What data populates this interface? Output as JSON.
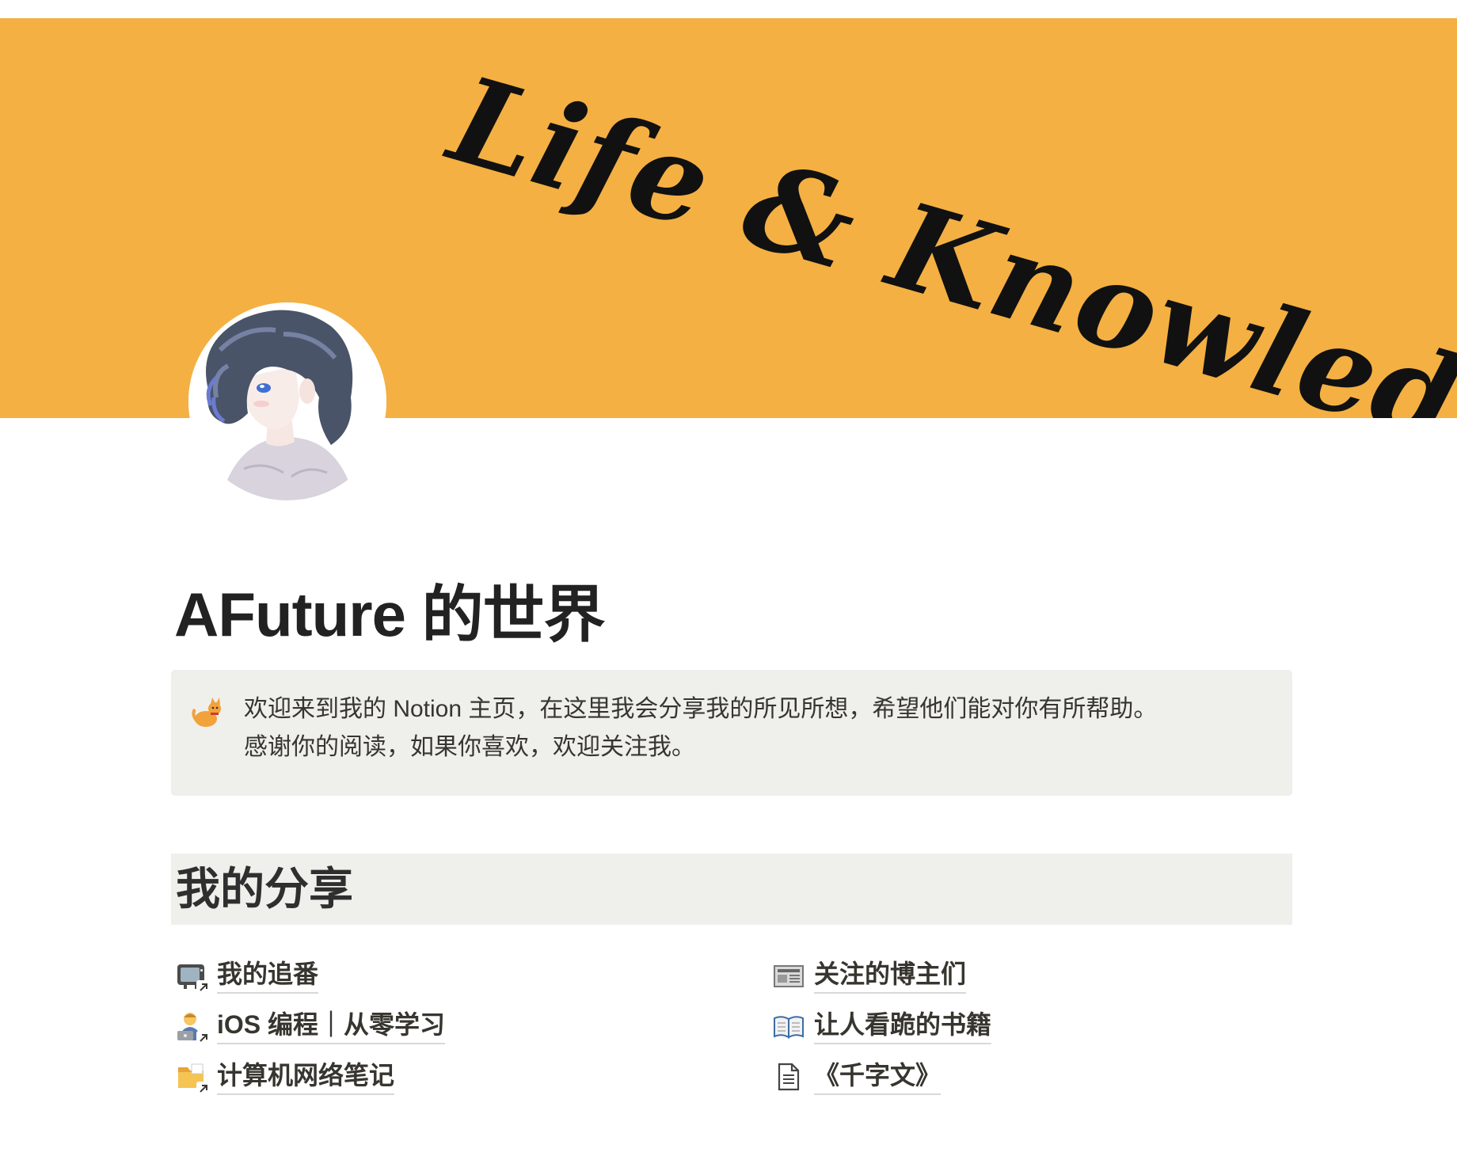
{
  "cover": {
    "text": "Life & Knowledge.",
    "color": "#f4b042"
  },
  "page": {
    "title": "AFuture 的世界"
  },
  "callout": {
    "icon": "cat-icon",
    "line1": "欢迎来到我的 Notion 主页，在这里我会分享我的所见所想，希望他们能对你有所帮助。",
    "line2": "感谢你的阅读，如果你喜欢，欢迎关注我。"
  },
  "section": {
    "heading": "我的分享"
  },
  "links": {
    "left": [
      {
        "label": "我的追番",
        "icon": "television-icon"
      },
      {
        "label": "iOS 编程｜从零学习",
        "icon": "technologist-icon"
      },
      {
        "label": "计算机网络笔记",
        "icon": "folder-icon"
      }
    ],
    "right": [
      {
        "label": "关注的博主们",
        "icon": "newspaper-icon"
      },
      {
        "label": "让人看跪的书籍",
        "icon": "open-book-icon"
      },
      {
        "label": "《千字文》",
        "icon": "document-icon"
      }
    ]
  }
}
